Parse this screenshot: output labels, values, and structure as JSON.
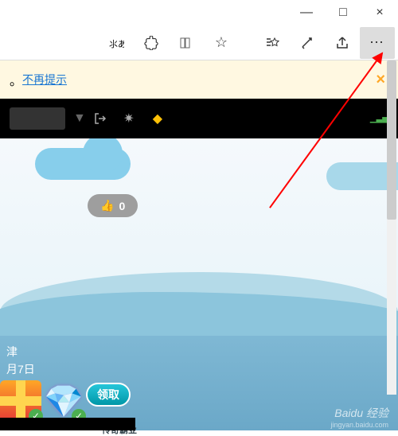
{
  "window": {
    "minimize": "—",
    "maximize": "□",
    "close": "×"
  },
  "toolbar": {
    "translate": "⺀あ",
    "extensions": "✦",
    "readlist": "⫿⫿",
    "favorite": "☆",
    "favorites_list": "≡☆",
    "collections": "✎",
    "share": "⮹",
    "more": "⋯"
  },
  "notice": {
    "prefix": "。",
    "link_text": "不再提示",
    "close": "×"
  },
  "blackbar": {
    "exit": "⎋",
    "settings": "✷",
    "diamond": "◆",
    "signal": "▁▃▅"
  },
  "like": {
    "icon": "👍",
    "count": "0"
  },
  "footer": {
    "line1": "津",
    "line2": "月7日",
    "claim": "领取",
    "sub": "传奇霸业"
  },
  "watermark": {
    "main": "Baidu 经验",
    "sub": "jingyan.baidu.com"
  }
}
